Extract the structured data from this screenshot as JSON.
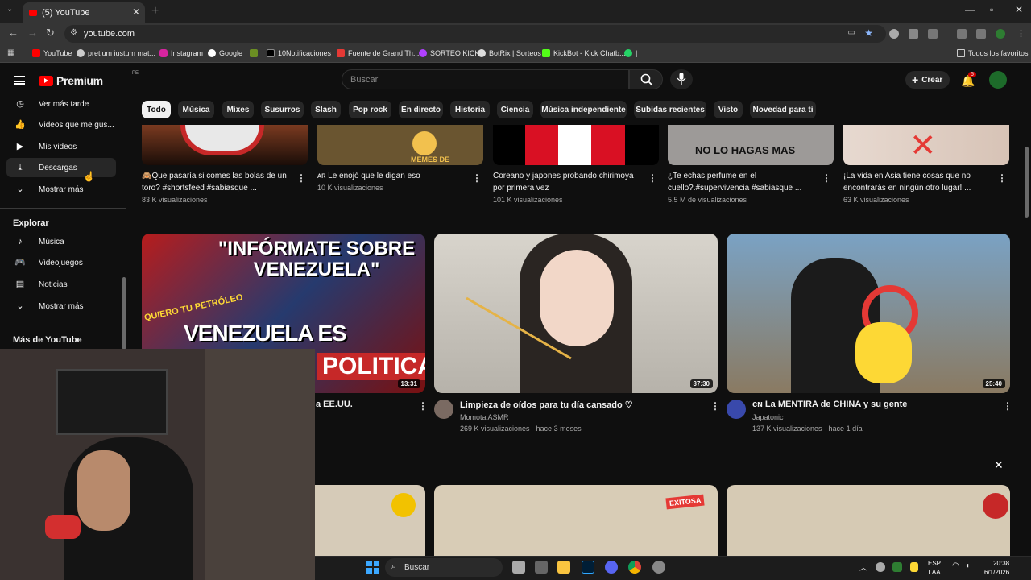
{
  "browser": {
    "tab_title": "(5) YouTube",
    "url": "youtube.com",
    "bookmarks": [
      "YouTube",
      "pretium iustum mat...",
      "Instagram",
      "Google",
      "10Notificaciones",
      "Fuente de Grand Th...",
      "SORTEO KICK",
      "BotRix | Sorteos",
      "KickBot - Kick Chatb...",
      "|"
    ],
    "all_favorites": "Todos los favoritos"
  },
  "header": {
    "logo_text": "Premium",
    "logo_country": "PE",
    "search_placeholder": "Buscar",
    "create_label": "Crear",
    "notifications_count": "5"
  },
  "sidebar": {
    "items": [
      {
        "label": "Ver más tarde",
        "icon": "clock-icon"
      },
      {
        "label": "Videos que me gus...",
        "icon": "thumb-up-icon"
      },
      {
        "label": "Mis videos",
        "icon": "video-icon"
      },
      {
        "label": "Descargas",
        "icon": "download-icon"
      },
      {
        "label": "Mostrar más",
        "icon": "chevron-down-icon"
      }
    ],
    "explore_heading": "Explorar",
    "explore_items": [
      {
        "label": "Música",
        "icon": "music-icon"
      },
      {
        "label": "Videojuegos",
        "icon": "gamepad-icon"
      },
      {
        "label": "Noticias",
        "icon": "news-icon"
      },
      {
        "label": "Mostrar más",
        "icon": "chevron-down-icon"
      }
    ],
    "more_heading": "Más de YouTube"
  },
  "chips": [
    "Todo",
    "Música",
    "Mixes",
    "Susurros",
    "Slash",
    "Pop rock",
    "En directo",
    "Historia",
    "Ciencia",
    "Música independiente",
    "Subidas recientes",
    "Visto",
    "Novedad para ti"
  ],
  "shorts": [
    {
      "title": "🙈Que pasaría si comes las bolas de un toro? #shortsfeed #sabiasque ...",
      "views": "83 K visualizaciones"
    },
    {
      "title": "ᴀʀ Le enojó que le digan eso",
      "views": "10 K visualizaciones",
      "overlay": "MEMES DE"
    },
    {
      "title": "Coreano y japones probando chirimoya por primera vez",
      "views": "101 K visualizaciones"
    },
    {
      "title": "¿Te echas perfume en el cuello?.#supervivencia #sabiasque ...",
      "views": "5,5 M de visualizaciones",
      "overlay": "NO LO HAGAS MAS"
    },
    {
      "title": "¡La vida en Asia tiene cosas que no encontrarás en ningún otro lugar! ...",
      "views": "63 K visualizaciones"
    }
  ],
  "videos": [
    {
      "title": "a EE.UU.",
      "duration": "13:31",
      "thumb_text1": "\"INFÓRMATE SOBRE VENEZUELA\"",
      "thumb_text2": "VENEZUELA ES USADA",
      "thumb_text3": "POLITICA",
      "thumb_text4": "QUIERO TU PETRÓLEO"
    },
    {
      "title": "Limpieza de oídos para tu día cansado ♡",
      "channel": "Momota ASMR",
      "meta": "269 K visualizaciones · hace 3 meses",
      "duration": "37:30"
    },
    {
      "title": "ᴄɴ La MENTIRA de CHINA y su gente",
      "channel": "Japatonic",
      "meta": "137 K visualizaciones · hace 1 día",
      "duration": "25:40"
    }
  ],
  "bottom_row_badges": [
    "EXITOSA"
  ],
  "taskbar": {
    "search_label": "Buscar",
    "lang_top": "ESP",
    "lang_bottom": "LAA",
    "time": "20:38",
    "date": "6/1/2026"
  }
}
